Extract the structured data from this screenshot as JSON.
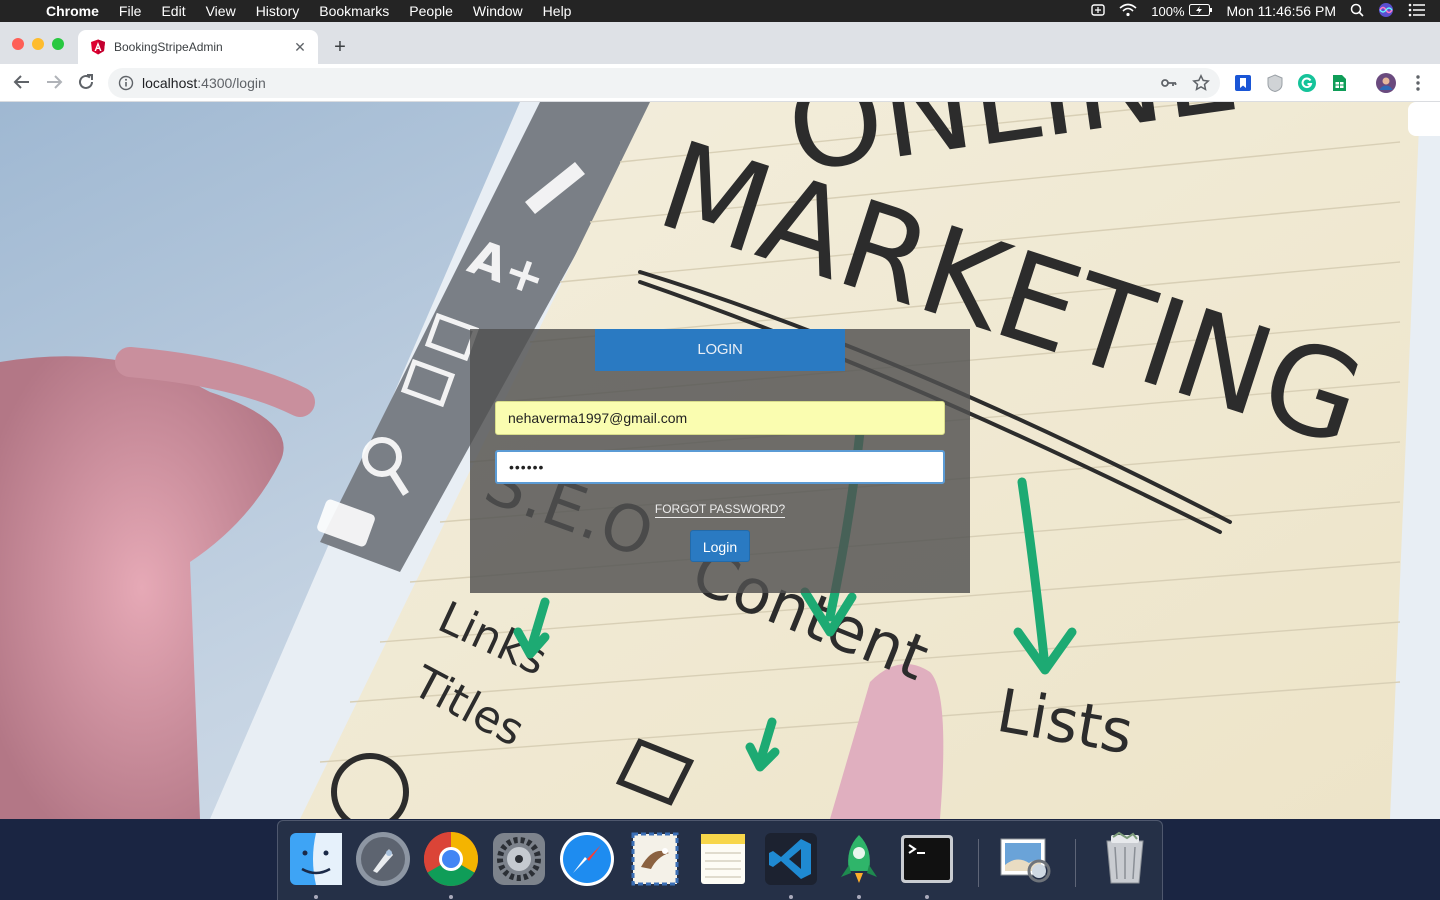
{
  "menubar": {
    "app": "Chrome",
    "items": [
      "File",
      "Edit",
      "View",
      "History",
      "Bookmarks",
      "People",
      "Window",
      "Help"
    ],
    "battery": "100%",
    "clock": "Mon 11:46:56 PM"
  },
  "browser": {
    "tab_title": "BookingStripeAdmin",
    "url_host": "localhost",
    "url_path": ":4300/login"
  },
  "login": {
    "header": "LOGIN",
    "email_value": "nehaverma1997@gmail.com",
    "password_value": "••••••",
    "forgot_label": "FORGOT PASSWORD?",
    "button_label": "Login"
  },
  "background": {
    "words": [
      "ONLINE",
      "MARKETING",
      "S.E.O",
      "Content",
      "Lists",
      "Links",
      "Titles"
    ]
  },
  "dock": {
    "apps": [
      "Finder",
      "Launchpad",
      "Google Chrome",
      "System Preferences",
      "Safari",
      "Mail",
      "Notes",
      "Visual Studio Code",
      "RoboMongo",
      "Terminal",
      "Preview",
      "Trash"
    ]
  }
}
